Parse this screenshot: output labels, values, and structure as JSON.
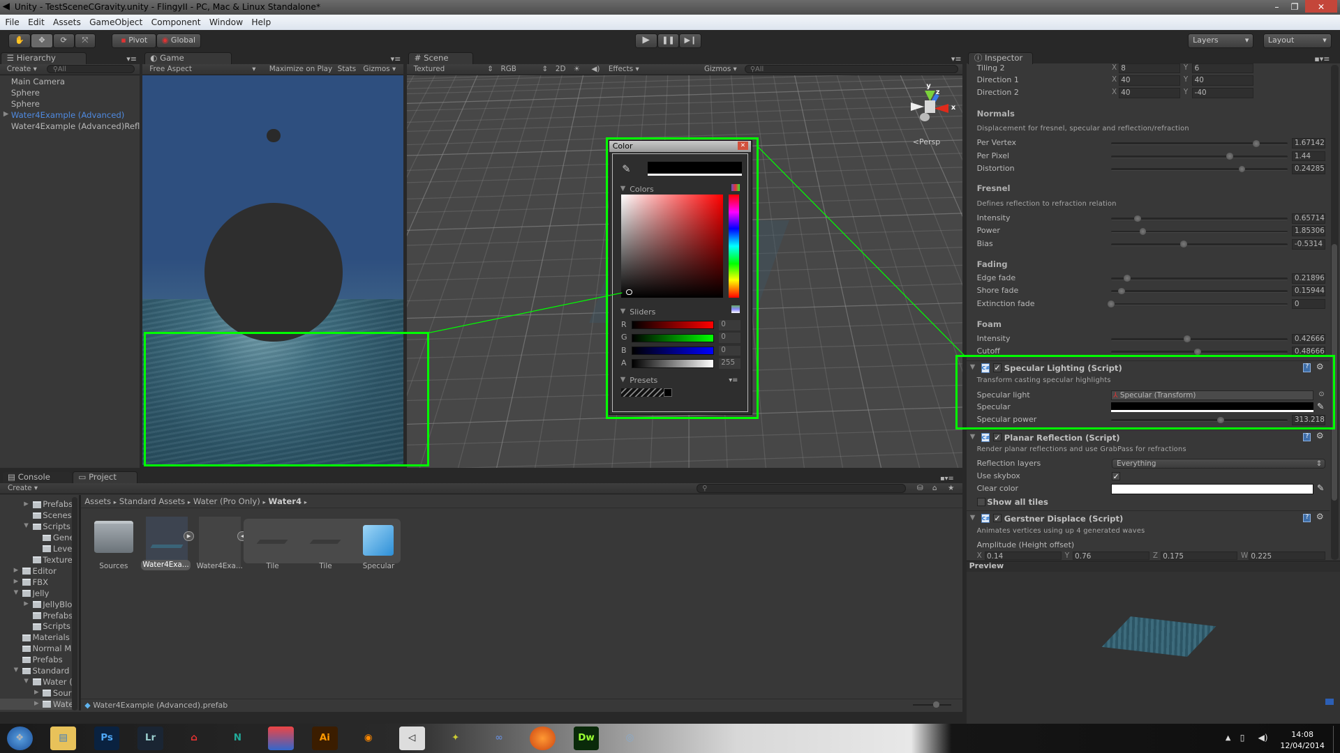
{
  "window": {
    "title": "Unity - TestSceneCGravity.unity - FlingyII - PC, Mac & Linux Standalone*"
  },
  "menu": [
    "File",
    "Edit",
    "Assets",
    "GameObject",
    "Component",
    "Window",
    "Help"
  ],
  "toolbar": {
    "pivot": "Pivot",
    "global": "Global",
    "layers": "Layers",
    "layout": "Layout"
  },
  "hierarchy": {
    "tab": "Hierarchy",
    "create": "Create",
    "search_placeholder": "All",
    "items": [
      "Main Camera",
      "Sphere",
      "Sphere",
      "Water4Example (Advanced)",
      "Water4Example (Advanced)Refl"
    ]
  },
  "game": {
    "tab": "Game",
    "aspect": "Free Aspect",
    "maximize": "Maximize on Play",
    "stats": "Stats",
    "gizmos": "Gizmos",
    "sky_color": "#2e4f7f"
  },
  "scene": {
    "tab": "Scene",
    "shading": "Textured",
    "render_mode": "RGB",
    "mode_2d": "2D",
    "effects": "Effects",
    "gizmos": "Gizmos",
    "search_placeholder": "All",
    "persp": "Persp",
    "axes": {
      "x": "x",
      "y": "y",
      "z": "z"
    }
  },
  "color_picker": {
    "title": "Color",
    "current_color": "#000000",
    "colors_label": "Colors",
    "sliders_label": "Sliders",
    "presets_label": "Presets",
    "hue_color": "#ff0000",
    "channels": [
      {
        "label": "R",
        "value": "0",
        "color": "#ff0000"
      },
      {
        "label": "G",
        "value": "0",
        "color": "#00ff00"
      },
      {
        "label": "B",
        "value": "0",
        "color": "#0000ff"
      },
      {
        "label": "A",
        "value": "255",
        "color": "#ffffff"
      }
    ]
  },
  "inspector": {
    "tab": "Inspector",
    "vectors": [
      {
        "label": "Tiling 2",
        "x": "8",
        "y": "6"
      },
      {
        "label": "Direction 1",
        "x": "40",
        "y": "40"
      },
      {
        "label": "Direction 2",
        "x": "40",
        "y": "-40"
      }
    ],
    "normals": {
      "header": "Normals",
      "desc": "Displacement for fresnel, specular and reflection/refraction",
      "rows": [
        {
          "label": "Per Vertex",
          "value": "1.67142",
          "level": 0.82
        },
        {
          "label": "Per Pixel",
          "value": "1.44",
          "level": 0.67
        },
        {
          "label": "Distortion",
          "value": "0.24285",
          "level": 0.74
        }
      ]
    },
    "fresnel": {
      "header": "Fresnel",
      "desc": "Defines reflection to refraction relation",
      "rows": [
        {
          "label": "Intensity",
          "value": "0.65714",
          "level": 0.15
        },
        {
          "label": "Power",
          "value": "1.85306",
          "level": 0.18
        },
        {
          "label": "Bias",
          "value": "-0.5314",
          "level": 0.41
        }
      ]
    },
    "fading": {
      "header": "Fading",
      "rows": [
        {
          "label": "Edge fade",
          "value": "0.21896",
          "level": 0.09
        },
        {
          "label": "Shore fade",
          "value": "0.15944",
          "level": 0.06
        },
        {
          "label": "Extinction fade",
          "value": "0",
          "level": 0.0
        }
      ]
    },
    "foam": {
      "header": "Foam",
      "rows": [
        {
          "label": "Intensity",
          "value": "0.42666",
          "level": 0.43
        },
        {
          "label": "Cutoff",
          "value": "0.48666",
          "level": 0.49
        }
      ]
    },
    "specular_lighting": {
      "title": "Specular Lighting (Script)",
      "desc": "Transform casting specular highlights",
      "specular_light_label": "Specular light",
      "specular_light_value": "Specular (Transform)",
      "specular_label": "Specular",
      "specular_color": "#000000",
      "power_label": "Specular power",
      "power_value": "313.218",
      "power_level": 0.62
    },
    "planar_reflection": {
      "title": "Planar Reflection (Script)",
      "desc": "Render planar reflections and use GrabPass for refractions",
      "layers_label": "Reflection layers",
      "layers_value": "Everything",
      "skybox_label": "Use skybox",
      "skybox_checked": true,
      "clear_label": "Clear color",
      "clear_color": "#ffffff",
      "show_tiles_label": "Show all tiles"
    },
    "gerstner": {
      "title": "Gerstner Displace (Script)",
      "desc": "Animates vertices using up 4 generated waves",
      "amplitude_label": "Amplitude (Height offset)",
      "x": "0.14",
      "y": "0.76",
      "z": "0.175",
      "w": "0.225"
    },
    "preview_label": "Preview"
  },
  "console_tab": "Console",
  "project": {
    "tab": "Project",
    "create": "Create",
    "breadcrumb": [
      "Assets",
      "Standard Assets",
      "Water (Pro Only)",
      "Water4"
    ],
    "tree": [
      "Prefabs",
      "Scenes",
      "Scripts",
      "Gene",
      "Leve",
      "Texture",
      "Editor",
      "FBX",
      "Jelly",
      "JellyBlo",
      "Prefabs",
      "Scripts",
      "Materials",
      "Normal M",
      "Prefabs",
      "Standard",
      "Water (",
      "Sour",
      "Wate"
    ],
    "assets": [
      "Sources",
      "Water4Exa...",
      "Water4Exa...",
      "Tile",
      "Tile",
      "Specular"
    ],
    "status": "Water4Example (Advanced).prefab"
  },
  "taskbar": {
    "apps": [
      "start",
      "explorer",
      "Ps",
      "Lr",
      "app-red",
      "N",
      "app-paint",
      "Ai",
      "blender",
      "unity",
      "app-green",
      "visual-studio",
      "firefox",
      "Dw",
      "app-globe"
    ],
    "time": "14:08",
    "date": "12/04/2014"
  }
}
